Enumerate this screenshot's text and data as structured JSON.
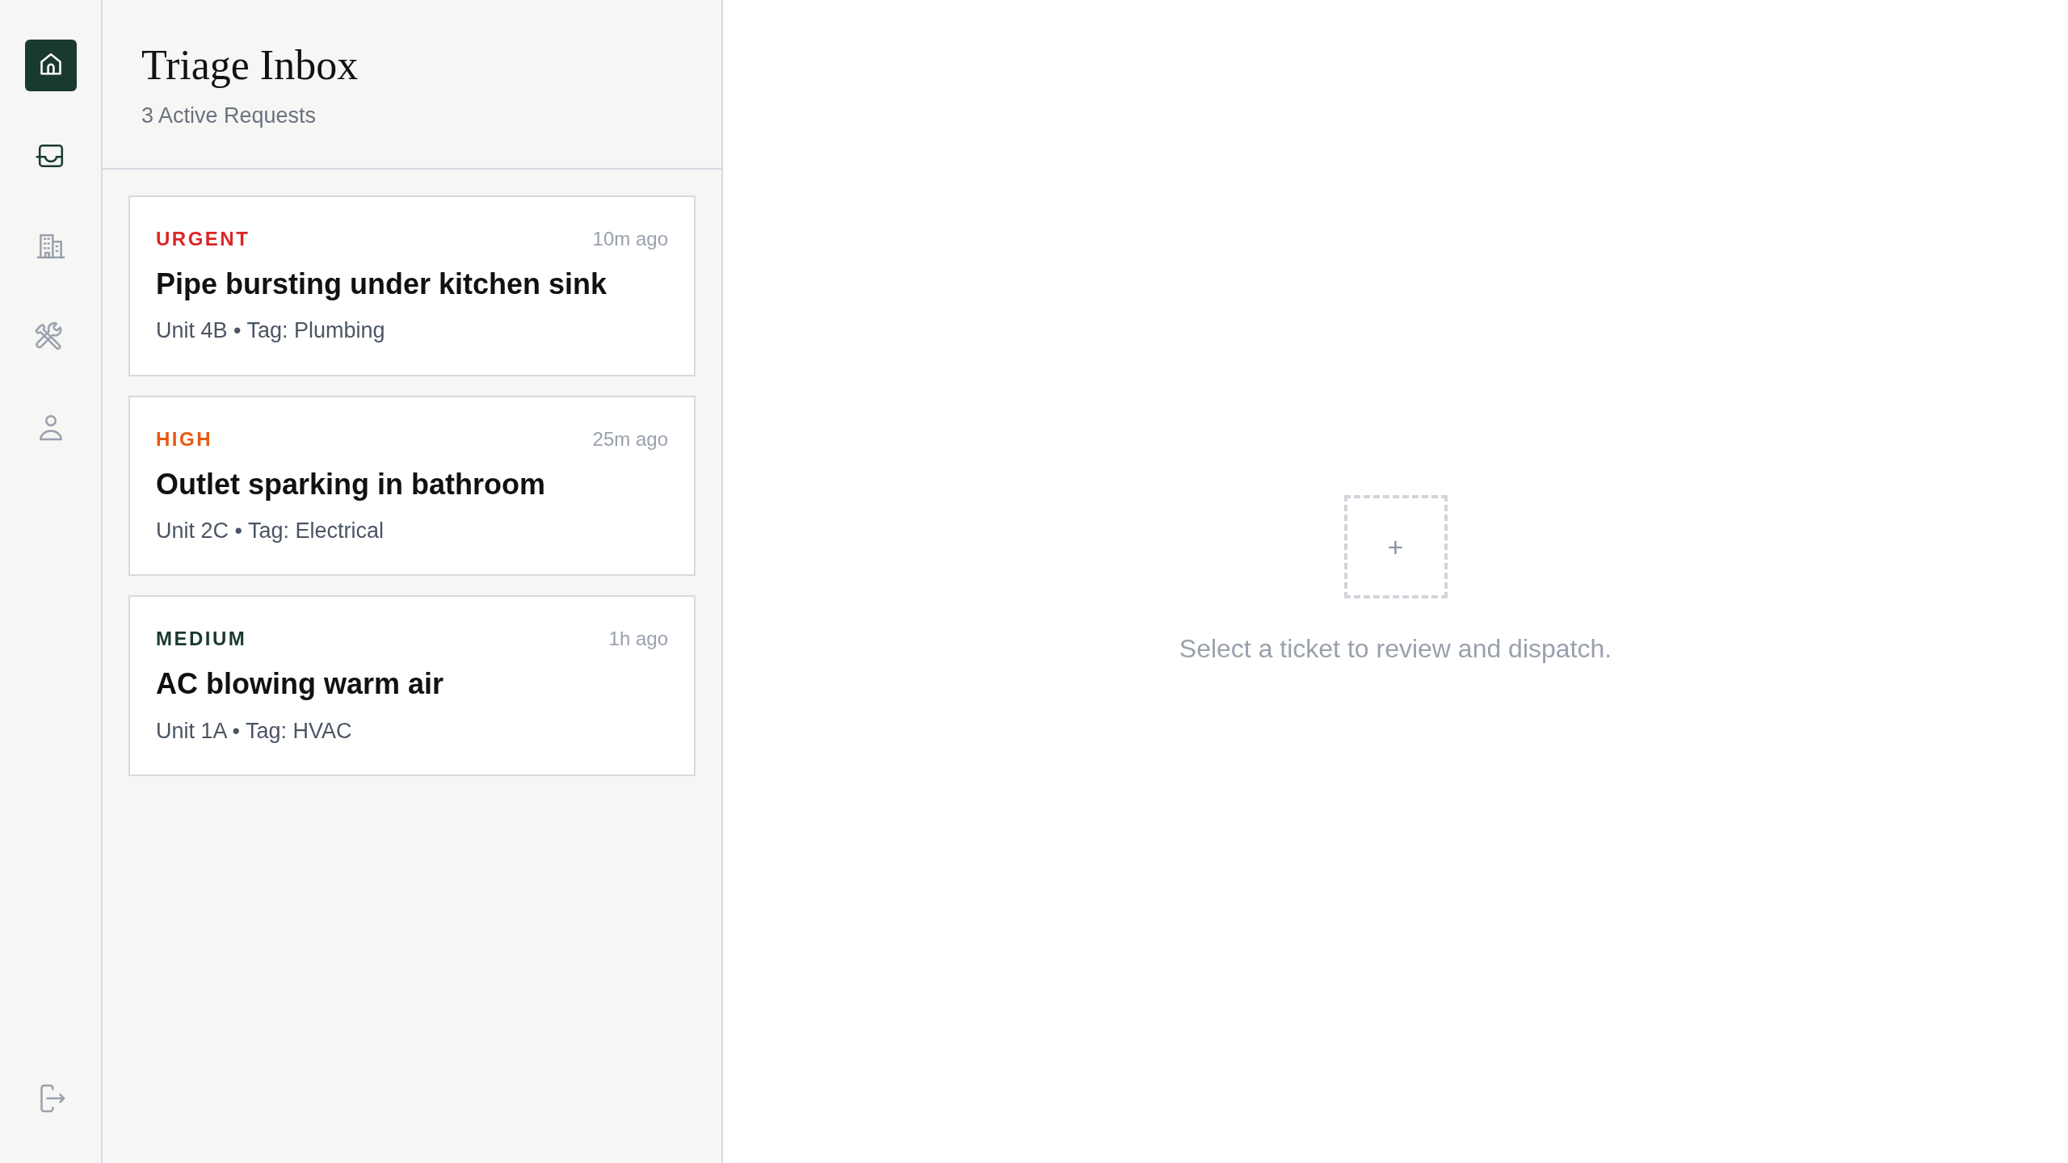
{
  "rail": {
    "items": [
      {
        "kind": "home",
        "selected": true,
        "active": false
      },
      {
        "kind": "inbox",
        "selected": false,
        "active": true
      },
      {
        "kind": "building",
        "selected": false,
        "active": false
      },
      {
        "kind": "tools",
        "selected": false,
        "active": false
      },
      {
        "kind": "user",
        "selected": false,
        "active": false
      }
    ]
  },
  "list": {
    "title": "Triage Inbox",
    "subtitle": "3 Active Requests",
    "tickets": [
      {
        "priority": "URGENT",
        "color": "#dc2626",
        "time": "10m ago",
        "title": "Pipe bursting under kitchen sink",
        "meta": "Unit 4B • Tag: Plumbing"
      },
      {
        "priority": "HIGH",
        "color": "#ea580c",
        "time": "25m ago",
        "title": "Outlet sparking in bathroom",
        "meta": "Unit 2C • Tag: Electrical"
      },
      {
        "priority": "MEDIUM",
        "color": "#1a3a2e",
        "time": "1h ago",
        "title": "AC blowing warm air",
        "meta": "Unit 1A • Tag: HVAC"
      }
    ]
  },
  "detail": {
    "empty_icon": "+",
    "message": "Select a ticket to review and dispatch."
  }
}
